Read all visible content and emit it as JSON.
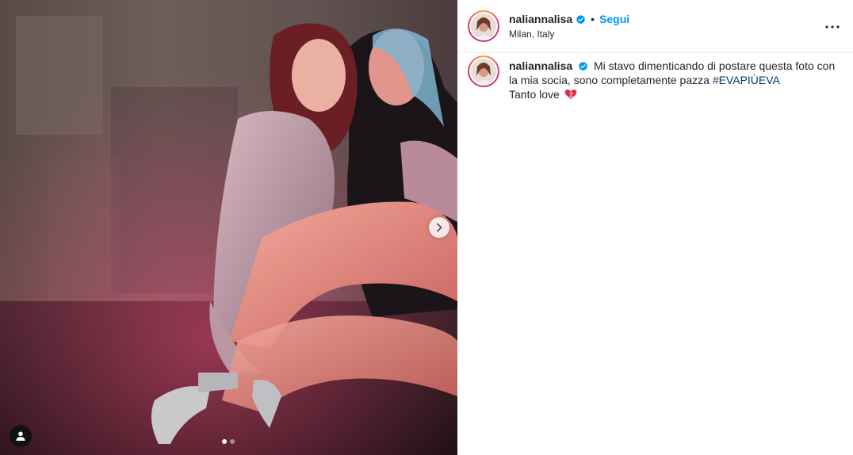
{
  "post": {
    "username": "naliannalisa",
    "separator": "•",
    "follow_label": "Segui",
    "location": "Milan, Italy",
    "caption": {
      "username": "naliannalisa",
      "text_before_tag": "Mi stavo dimenticando di postare questa foto con la mia socia, sono completamente pazza",
      "hashtag": "#EVAPIÙEVA",
      "second_line": "Tanto love"
    }
  },
  "media": {
    "carousel_dots": 2,
    "active_dot": 1
  },
  "icons": {
    "verified": "verified-badge-icon",
    "more": "more-options-icon",
    "next": "chevron-right-icon",
    "tag": "user-tag-icon",
    "heart": "heart-emoji-icon"
  },
  "colors": {
    "link_blue": "#0095f6",
    "hashtag": "#00376b",
    "verified": "#0095f6",
    "text": "#262626"
  }
}
